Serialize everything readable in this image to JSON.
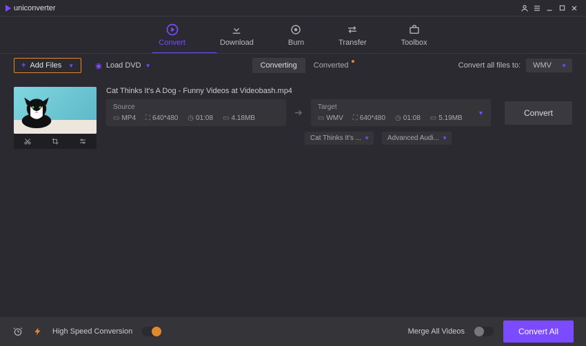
{
  "app_title": "uniconverter",
  "nav": [
    {
      "label": "Convert",
      "icon": "convert"
    },
    {
      "label": "Download",
      "icon": "download"
    },
    {
      "label": "Burn",
      "icon": "burn"
    },
    {
      "label": "Transfer",
      "icon": "transfer"
    },
    {
      "label": "Toolbox",
      "icon": "toolbox"
    }
  ],
  "active_nav_index": 0,
  "toolbar": {
    "add_files_label": "Add Files",
    "load_dvd_label": "Load DVD",
    "tabs": [
      {
        "label": "Converting",
        "active": true,
        "badge": false
      },
      {
        "label": "Converted",
        "active": false,
        "badge": true
      }
    ],
    "convert_all_label": "Convert all files to:",
    "convert_all_format": "WMV"
  },
  "file": {
    "name": "Cat Thinks It's A Dog - Funny Videos at Videobash.mp4",
    "source": {
      "title": "Source",
      "format": "MP4",
      "resolution": "640*480",
      "duration": "01:08",
      "size": "4.18MB"
    },
    "target": {
      "title": "Target",
      "format": "WMV",
      "resolution": "640*480",
      "duration": "01:08",
      "size": "5.19MB"
    },
    "subtitle_select": "Cat Thinks It's ...",
    "audio_select": "Advanced Audi...",
    "convert_label": "Convert"
  },
  "bottom": {
    "hsc_label": "High Speed Conversion",
    "hsc_on": true,
    "merge_label": "Merge All Videos",
    "merge_on": false,
    "convert_all_btn": "Convert All"
  }
}
